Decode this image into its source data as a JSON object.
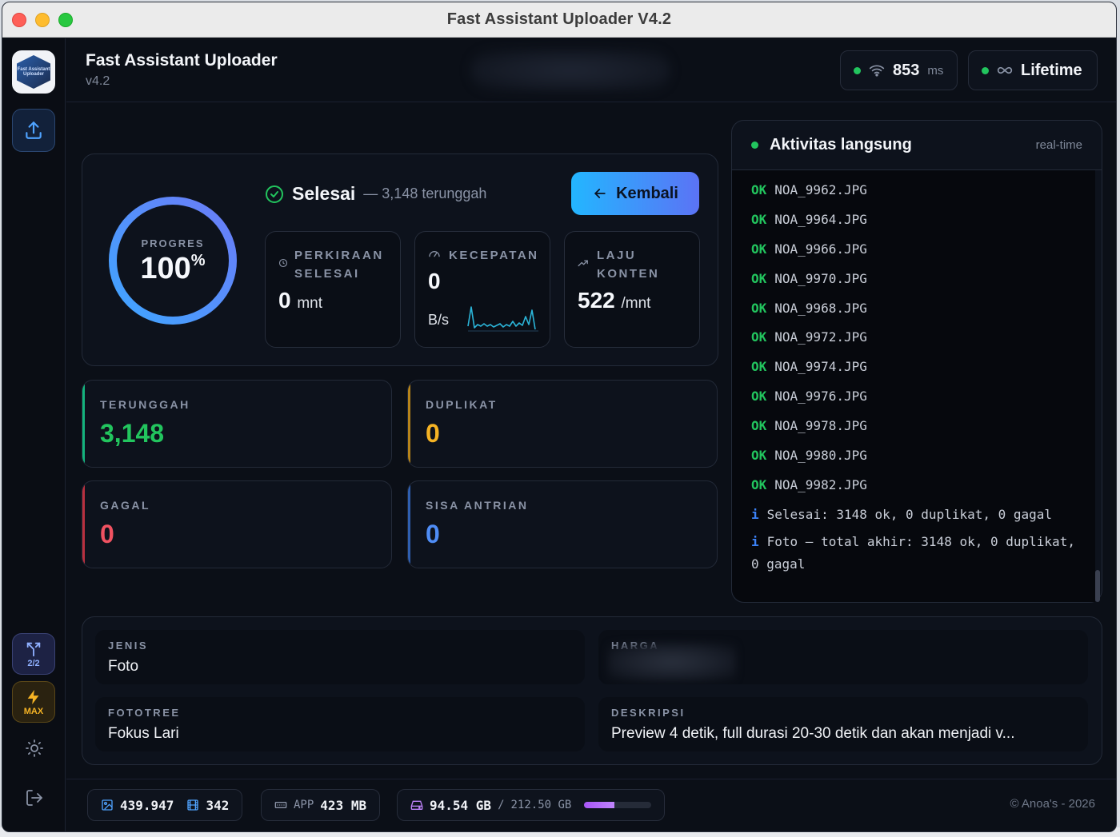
{
  "window": {
    "title": "Fast Assistant Uploader V4.2"
  },
  "sidebar": {
    "logo_text": "Fast Assistant Uploader",
    "route_label": "2/2",
    "max_label": "MAX"
  },
  "header": {
    "app_name": "Fast Assistant Uploader",
    "version": "v4.2",
    "ping_value": "853",
    "ping_unit": "ms",
    "license": "Lifetime"
  },
  "progress": {
    "label": "PROGRES",
    "value": "100",
    "percent_sign": "%",
    "fraction": 1.0,
    "status": "Selesai",
    "status_sub": "— 3,148 terunggah",
    "back_label": "Kembali"
  },
  "stats": {
    "eta_label_1": "PERKIRAAN",
    "eta_label_2": "SELESAI",
    "eta_value": "0",
    "eta_unit": "mnt",
    "speed_label": "KECEPATAN",
    "speed_value": "0",
    "speed_unit": "B/s",
    "rate_label_1": "LAJU",
    "rate_label_2": "KONTEN",
    "rate_value": "522",
    "rate_unit": "/mnt"
  },
  "counts": {
    "uploaded_label": "TERUNGGAH",
    "uploaded_value": "3,148",
    "duplicate_label": "DUPLIKAT",
    "duplicate_value": "0",
    "failed_label": "GAGAL",
    "failed_value": "0",
    "queue_label": "SISA ANTRIAN",
    "queue_value": "0"
  },
  "colors": {
    "green": "#22c55e",
    "amber": "#f5b324",
    "red": "#f05261",
    "blue": "#4f8df6"
  },
  "activity": {
    "title": "Aktivitas langsung",
    "mode": "real-time",
    "ok_tag": "OK",
    "info_tag": "i",
    "files": [
      "NOA_9962.JPG",
      "NOA_9964.JPG",
      "NOA_9966.JPG",
      "NOA_9970.JPG",
      "NOA_9968.JPG",
      "NOA_9972.JPG",
      "NOA_9974.JPG",
      "NOA_9976.JPG",
      "NOA_9978.JPG",
      "NOA_9980.JPG",
      "NOA_9982.JPG"
    ],
    "summary_1": "Selesai: 3148 ok, 0 duplikat, 0 gagal",
    "summary_2": "Foto — total akhir: 3148 ok, 0 duplikat, 0 gagal"
  },
  "details": {
    "type_label": "JENIS",
    "type_value": "Foto",
    "price_label": "HARGA",
    "tree_label": "FOTOTREE",
    "tree_value": "Fokus Lari",
    "desc_label": "DESKRIPSI",
    "desc_value": "Preview 4 detik, full durasi 20-30 detik dan akan menjadi v..."
  },
  "footer": {
    "images": "439.947",
    "videos": "342",
    "app_label": "APP",
    "app_mem": "423 MB",
    "disk_used": "94.54 GB",
    "disk_sep": "/",
    "disk_total": "212.50 GB",
    "disk_fraction": 0.445,
    "copyright": "© Anoa's - 2026"
  }
}
